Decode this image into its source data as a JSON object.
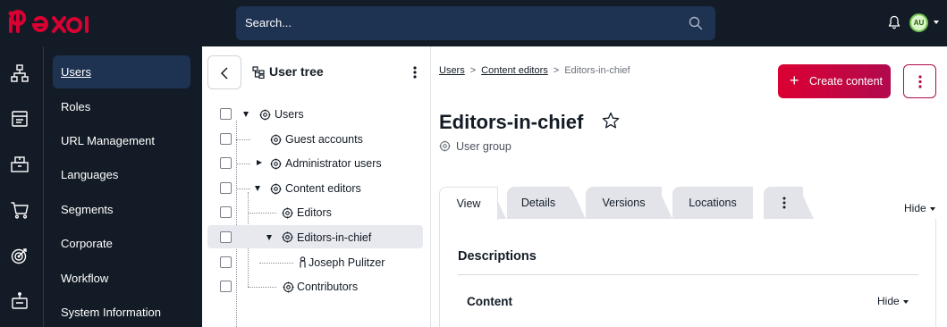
{
  "search": {
    "placeholder": "Search..."
  },
  "user": {
    "initials": "AU"
  },
  "subnav": {
    "items": [
      {
        "label": "Users",
        "active": true
      },
      {
        "label": "Roles"
      },
      {
        "label": "URL Management"
      },
      {
        "label": "Languages"
      },
      {
        "label": "Segments"
      },
      {
        "label": "Corporate"
      },
      {
        "label": "Workflow"
      },
      {
        "label": "System Information"
      }
    ]
  },
  "tree": {
    "title": "User tree",
    "nodes": [
      {
        "label": "Users"
      },
      {
        "label": "Guest accounts"
      },
      {
        "label": "Administrator users"
      },
      {
        "label": "Content editors"
      },
      {
        "label": "Editors"
      },
      {
        "label": "Editors-in-chief",
        "selected": true
      },
      {
        "label": "Joseph Pulitzer"
      },
      {
        "label": "Contributors"
      }
    ]
  },
  "breadcrumb": {
    "items": [
      "Users",
      "Content editors"
    ],
    "separator": ">",
    "current": "Editors-in-chief"
  },
  "actions": {
    "create_label": "Create content"
  },
  "page": {
    "title": "Editors-in-chief",
    "subtitle": "User group"
  },
  "tabs": [
    {
      "label": "View",
      "active": true
    },
    {
      "label": "Details"
    },
    {
      "label": "Versions"
    },
    {
      "label": "Locations"
    }
  ],
  "hide_label": "Hide",
  "section": {
    "title": "Descriptions",
    "content_label": "Content",
    "hide_label": "Hide"
  },
  "colors": {
    "topbar": "#131c26",
    "search_bg": "#1e3251",
    "accent_start": "#db0032",
    "accent_end": "#b10a4e"
  }
}
